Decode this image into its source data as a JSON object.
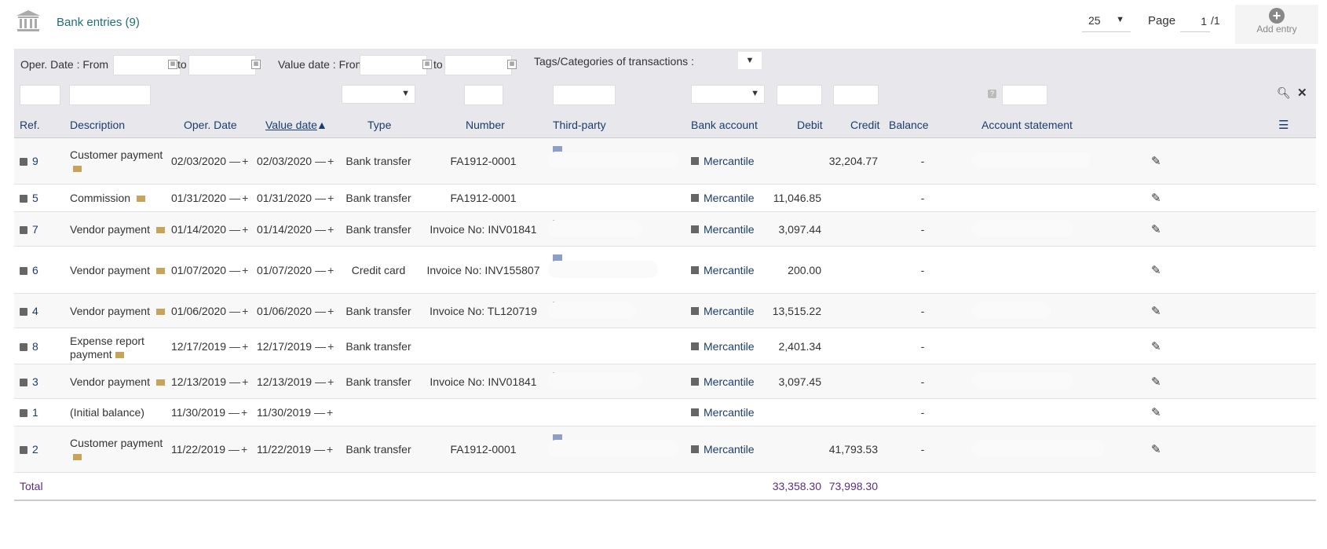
{
  "header": {
    "title": "Bank entries (9)",
    "limit": "25",
    "page_label": "Page",
    "page_current": "1",
    "page_total": "/1",
    "add_entry": "Add entry"
  },
  "filters": {
    "oper_date_from": "Oper. Date : From",
    "to": "to",
    "value_date_from": "Value date : From",
    "tags_label": "Tags/Categories of transactions :"
  },
  "columns": {
    "ref": "Ref.",
    "description": "Description",
    "oper_date": "Oper. Date",
    "value_date": "Value date",
    "type": "Type",
    "number": "Number",
    "third_party": "Third-party",
    "bank_account": "Bank account",
    "debit": "Debit",
    "credit": "Credit",
    "balance": "Balance",
    "account_statement": "Account statement"
  },
  "rows": [
    {
      "ref": "9",
      "desc": "Customer payment",
      "desc_line2": "",
      "oper": "02/03/2020",
      "value": "02/03/2020",
      "type": "Bank transfer",
      "number": "FA1912-0001",
      "bank": "Mercantile",
      "debit": "",
      "credit": "32,204.77",
      "balance": "-"
    },
    {
      "ref": "5",
      "desc": "Commission",
      "desc_line2": "",
      "oper": "01/31/2020",
      "value": "01/31/2020",
      "type": "Bank transfer",
      "number": "FA1912-0001",
      "bank": "Mercantile",
      "debit": "11,046.85",
      "credit": "",
      "balance": "-"
    },
    {
      "ref": "7",
      "desc": "Vendor payment",
      "desc_line2": "",
      "oper": "01/14/2020",
      "value": "01/14/2020",
      "type": "Bank transfer",
      "number": "Invoice No: INV01841",
      "bank": "Mercantile",
      "debit": "3,097.44",
      "credit": "",
      "balance": "-"
    },
    {
      "ref": "6",
      "desc": "Vendor payment",
      "desc_line2": "",
      "oper": "01/07/2020",
      "value": "01/07/2020",
      "type": "Credit card",
      "number": "Invoice No: INV155807",
      "bank": "Mercantile",
      "debit": "200.00",
      "credit": "",
      "balance": "-"
    },
    {
      "ref": "4",
      "desc": "Vendor payment",
      "desc_line2": "",
      "oper": "01/06/2020",
      "value": "01/06/2020",
      "type": "Bank transfer",
      "number": "Invoice No: TL120719",
      "bank": "Mercantile",
      "debit": "13,515.22",
      "credit": "",
      "balance": "-"
    },
    {
      "ref": "8",
      "desc": "Expense report",
      "desc_line2": "payment",
      "oper": "12/17/2019",
      "value": "12/17/2019",
      "type": "Bank transfer",
      "number": "",
      "bank": "Mercantile",
      "debit": "2,401.34",
      "credit": "",
      "balance": "-"
    },
    {
      "ref": "3",
      "desc": "Vendor payment",
      "desc_line2": "",
      "oper": "12/13/2019",
      "value": "12/13/2019",
      "type": "Bank transfer",
      "number": "Invoice No: INV01841",
      "bank": "Mercantile",
      "debit": "3,097.45",
      "credit": "",
      "balance": "-"
    },
    {
      "ref": "1",
      "desc": "(Initial balance)",
      "desc_line2": "",
      "oper": "11/30/2019",
      "value": "11/30/2019",
      "type": "",
      "number": "",
      "bank": "Mercantile",
      "debit": "",
      "credit": "",
      "balance": "-"
    },
    {
      "ref": "2",
      "desc": "Customer payment",
      "desc_line2": "",
      "oper": "11/22/2019",
      "value": "11/22/2019",
      "type": "Bank transfer",
      "number": "FA1912-0001",
      "bank": "Mercantile",
      "debit": "",
      "credit": "41,793.53",
      "balance": "-"
    }
  ],
  "total": {
    "label": "Total",
    "debit": "33,358.30",
    "credit": "73,998.30"
  }
}
